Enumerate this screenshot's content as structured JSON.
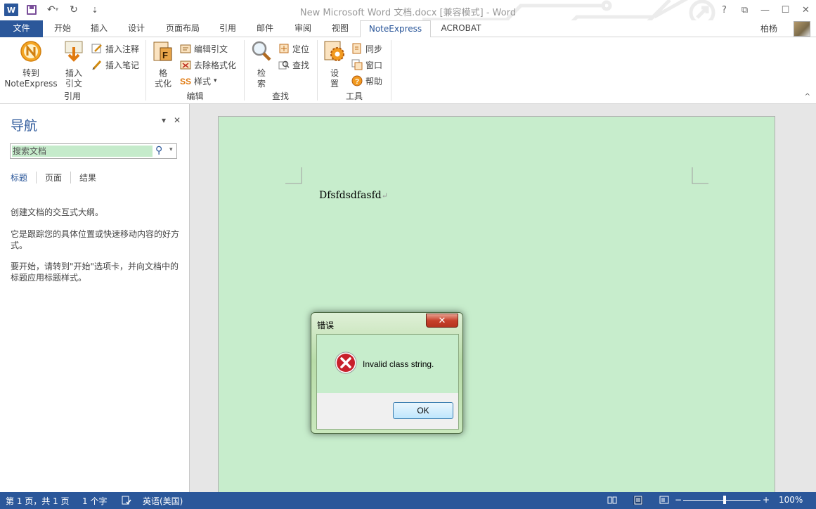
{
  "window": {
    "title": "New Microsoft Word 文档.docx [兼容模式] - Word",
    "help": "?",
    "ribbon_display": "⧉",
    "minimize": "—",
    "maximize": "☐",
    "close": "✕"
  },
  "qat": {
    "undo": "↶",
    "undo_arrow": "▾",
    "redo": "↻",
    "more": "⇣"
  },
  "tabs": {
    "file": "文件",
    "home": "开始",
    "insert": "插入",
    "design": "设计",
    "layout": "页面布局",
    "references": "引用",
    "mailings": "邮件",
    "review": "审阅",
    "view": "视图",
    "noteexpress": "NoteExpress",
    "acrobat": "ACROBAT"
  },
  "user": {
    "name": "柏杨"
  },
  "ribbon": {
    "cite_group": {
      "label": "引用",
      "goto_line1": "转到",
      "goto_line2": "NoteExpress",
      "insert_cite_line1": "插入",
      "insert_cite_line2": "引文",
      "insert_note": "插入注释",
      "insert_memo": "插入笔记"
    },
    "edit_group": {
      "label": "编辑",
      "format_line1": "格",
      "format_line2": "式化",
      "edit_cite": "编辑引文",
      "remove_format": "去除格式化",
      "style": "样式",
      "style_arrow": "▾"
    },
    "find_group": {
      "label": "查找",
      "search_line1": "检",
      "search_line2": "索",
      "locate": "定位",
      "find": "查找"
    },
    "tools_group": {
      "label": "工具",
      "settings_line1": "设",
      "settings_line2": "置",
      "sync": "同步",
      "window": "窗口",
      "help": "帮助"
    },
    "collapse": "^"
  },
  "nav": {
    "title": "导航",
    "dropdown": "▾",
    "close": "✕",
    "search_placeholder": "搜索文档",
    "search_icon": "⚲",
    "search_arrow": "▾",
    "tab_headings": "标题",
    "tab_pages": "页面",
    "tab_results": "结果",
    "p1": "创建文档的交互式大纲。",
    "p2": "它是跟踪您的具体位置或快速移动内容的好方式。",
    "p3": "要开始，请转到\"开始\"选项卡，并向文档中的标题应用标题样式。"
  },
  "document": {
    "text": "Dfsfdsdfasfd",
    "para_mark": "↵"
  },
  "dialog": {
    "title": "错误",
    "close": "✕",
    "message": "Invalid class string.",
    "ok": "OK"
  },
  "status": {
    "page": "第 1 页，共 1 页",
    "words": "1 个字",
    "language": "英语(美国)",
    "zoom_out": "−",
    "zoom_in": "+",
    "zoom": "100%"
  },
  "colors": {
    "word_blue": "#2b579a",
    "eye_protect_green": "#c7edcc",
    "error_red": "#c8202b"
  }
}
